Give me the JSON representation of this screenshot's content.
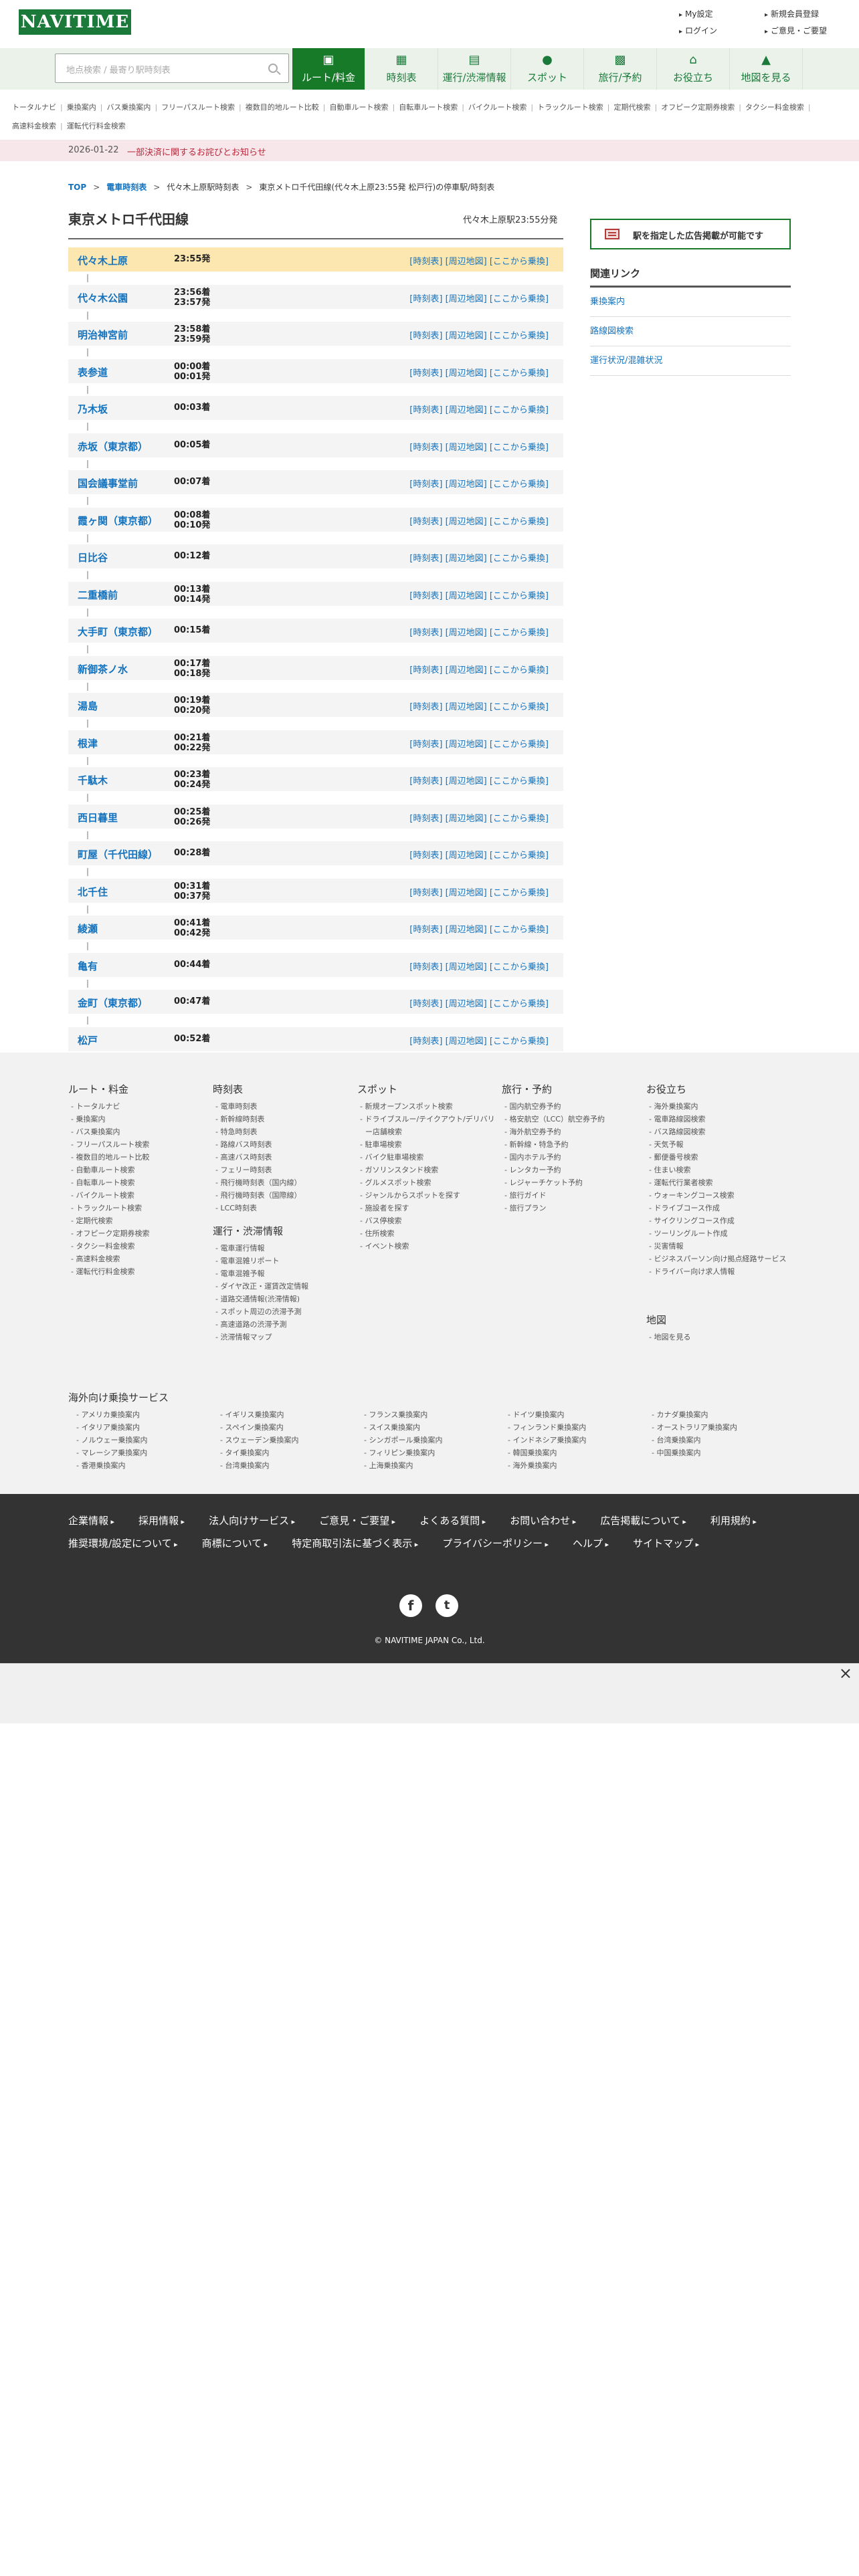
{
  "header": {
    "logo": "NAVITIME",
    "links": [
      "My設定",
      "新規会員登録",
      "ログイン",
      "ご意見・ご要望"
    ]
  },
  "search": {
    "placeholder": "地点検索 / 最寄り駅時刻表"
  },
  "nav_tabs": [
    {
      "label": "ルート/料金",
      "icon": "route-icon",
      "glyph": "▣"
    },
    {
      "label": "時刻表",
      "icon": "timetable-icon",
      "glyph": "▦"
    },
    {
      "label": "運行/渋滞情報",
      "icon": "train-icon",
      "glyph": "▤"
    },
    {
      "label": "スポット",
      "icon": "map-pin-icon",
      "glyph": "●"
    },
    {
      "label": "旅行/予約",
      "icon": "suitcase-icon",
      "glyph": "▩"
    },
    {
      "label": "お役立ち",
      "icon": "house-icon",
      "glyph": "⌂"
    },
    {
      "label": "地図を見る",
      "icon": "map-person-icon",
      "glyph": "▲"
    }
  ],
  "sub_links": [
    "トータルナビ",
    "乗換案内",
    "バス乗換案内",
    "フリーパスルート検索",
    "複数目的地ルート比較",
    "自動車ルート検索",
    "自転車ルート検索",
    "バイクルート検索",
    "トラックルート検索",
    "定期代検索",
    "オフピーク定期券検索",
    "タクシー料金検索",
    "高速料金検索",
    "運転代行料金検索"
  ],
  "notice": {
    "date": "2026-01-22",
    "text": "一部決済に関するお詫びとお知らせ"
  },
  "breadcrumb": [
    "TOP",
    "電車時刻表",
    "代々木上原駅時刻表",
    "東京メトロ千代田線(代々木上原23:55発 松戸行)の停車駅/時刻表"
  ],
  "main": {
    "title": "東京メトロ千代田線",
    "subtitle": "代々木上原駅23:55分発",
    "link_label": "[時刻表] [周辺地図] [ここから乗換]",
    "stops": [
      {
        "station": "代々木上原",
        "times": [
          "23:55発"
        ]
      },
      {
        "station": "代々木公園",
        "times": [
          "23:56着",
          "23:57発"
        ]
      },
      {
        "station": "明治神宮前",
        "times": [
          "23:58着",
          "23:59発"
        ]
      },
      {
        "station": "表参道",
        "times": [
          "00:00着",
          "00:01発"
        ]
      },
      {
        "station": "乃木坂",
        "times": [
          "00:03着"
        ]
      },
      {
        "station": "赤坂（東京都）",
        "times": [
          "00:05着"
        ]
      },
      {
        "station": "国会議事堂前",
        "times": [
          "00:07着"
        ]
      },
      {
        "station": "霞ヶ関（東京都）",
        "times": [
          "00:08着",
          "00:10発"
        ]
      },
      {
        "station": "日比谷",
        "times": [
          "00:12着"
        ]
      },
      {
        "station": "二重橋前",
        "times": [
          "00:13着",
          "00:14発"
        ]
      },
      {
        "station": "大手町（東京都）",
        "times": [
          "00:15着"
        ]
      },
      {
        "station": "新御茶ノ水",
        "times": [
          "00:17着",
          "00:18発"
        ]
      },
      {
        "station": "湯島",
        "times": [
          "00:19着",
          "00:20発"
        ]
      },
      {
        "station": "根津",
        "times": [
          "00:21着",
          "00:22発"
        ]
      },
      {
        "station": "千駄木",
        "times": [
          "00:23着",
          "00:24発"
        ]
      },
      {
        "station": "西日暮里",
        "times": [
          "00:25着",
          "00:26発"
        ]
      },
      {
        "station": "町屋（千代田線）",
        "times": [
          "00:28着"
        ]
      },
      {
        "station": "北千住",
        "times": [
          "00:31着",
          "00:37発"
        ]
      },
      {
        "station": "綾瀬",
        "times": [
          "00:41着",
          "00:42発"
        ]
      },
      {
        "station": "亀有",
        "times": [
          "00:44着"
        ]
      },
      {
        "station": "金町（東京都）",
        "times": [
          "00:47着"
        ]
      },
      {
        "station": "松戸",
        "times": [
          "00:52着"
        ]
      }
    ]
  },
  "side": {
    "ad_label": "駅を指定した広告掲載が可能です",
    "related_title": "関連リンク",
    "related_links": [
      "乗換案内",
      "路線図検索",
      "運行状況/混雑状況"
    ]
  },
  "footer": {
    "columns": [
      {
        "title": "ルート・料金",
        "items": [
          "トータルナビ",
          "乗換案内",
          "バス乗換案内",
          "フリーパスルート検索",
          "複数目的地ルート比較",
          "自動車ルート検索",
          "自転車ルート検索",
          "バイクルート検索",
          "トラックルート検索",
          "定期代検索",
          "オフピーク定期券検索",
          "タクシー料金検索",
          "高速料金検索",
          "運転代行料金検索"
        ]
      },
      {
        "title": "時刻表",
        "items": [
          "電車時刻表",
          "新幹線時刻表",
          "特急時刻表",
          "路線バス時刻表",
          "高速バス時刻表",
          "フェリー時刻表",
          "飛行機時刻表（国内線）",
          "飛行機時刻表（国際線）",
          "LCC時刻表"
        ],
        "title2": "運行・渋滞情報",
        "items2": [
          "電車運行情報",
          "電車混雑リポート",
          "電車混雑予報",
          "ダイヤ改正・運賃改定情報",
          "道路交通情報(渋滞情報)",
          "スポット周辺の渋滞予測",
          "高速道路の渋滞予測",
          "渋滞情報マップ"
        ]
      },
      {
        "title": "スポット",
        "items": [
          "新規オープンスポット検索",
          "ドライブスルー/テイクアウト/デリバリー店舗検索",
          "駐車場検索",
          "バイク駐車場検索",
          "ガソリンスタンド検索",
          "グルメスポット検索",
          "ジャンルからスポットを探す",
          "施設者を探す",
          "バス停検索",
          "住所検索",
          "イベント検索"
        ]
      },
      {
        "title": "旅行・予約",
        "items": [
          "国内航空券予約",
          "格安航空（LCC）航空券予約",
          "海外航空券予約",
          "新幹線・特急予約",
          "国内ホテル予約",
          "レンタカー予約",
          "レジャーチケット予約",
          "旅行ガイド",
          "旅行プラン"
        ]
      },
      {
        "title": "お役立ち",
        "items": [
          "海外乗換案内",
          "電車路線図検索",
          "バス路線図検索",
          "天気予報",
          "郵便番号検索",
          "住まい検索",
          "運転代行業者検索",
          "ウォーキングコース検索",
          "ドライブコース作成",
          "サイクリングコース作成",
          "ツーリングルート作成",
          "災害情報",
          "ビジネスパーソン向け拠点経路サービス",
          "ドライバー向け求人情報"
        ],
        "title2": "地図",
        "items2": [
          "地図を見る"
        ]
      }
    ],
    "overseas_title": "海外向け乗換サービス",
    "overseas": [
      "アメリカ乗換案内",
      "イギリス乗換案内",
      "フランス乗換案内",
      "ドイツ乗換案内",
      "カナダ乗換案内",
      "イタリア乗換案内",
      "スペイン乗換案内",
      "スイス乗換案内",
      "フィンランド乗換案内",
      "オーストラリア乗換案内",
      "ノルウェー乗換案内",
      "スウェーデン乗換案内",
      "シンガポール乗換案内",
      "インドネシア乗換案内",
      "台湾乗換案内",
      "マレーシア乗換案内",
      "タイ乗換案内",
      "フィリピン乗換案内",
      "韓国乗換案内",
      "中国乗換案内",
      "香港乗換案内",
      "台湾乗換案内",
      "上海乗換案内",
      "海外乗換案内"
    ],
    "bottom_links": [
      "企業情報",
      "採用情報",
      "法人向けサービス",
      "ご意見・ご要望",
      "よくある質問",
      "お問い合わせ",
      "広告掲載について",
      "利用規約",
      "推奨環境/設定について",
      "商標について",
      "特定商取引法に基づく表示",
      "プライバシーポリシー",
      "ヘルプ",
      "サイトマップ"
    ],
    "sns": [
      "facebook-icon",
      "twitter-icon"
    ],
    "copyright": "© NAVITIME JAPAN Co., Ltd."
  },
  "ad_close": "×"
}
